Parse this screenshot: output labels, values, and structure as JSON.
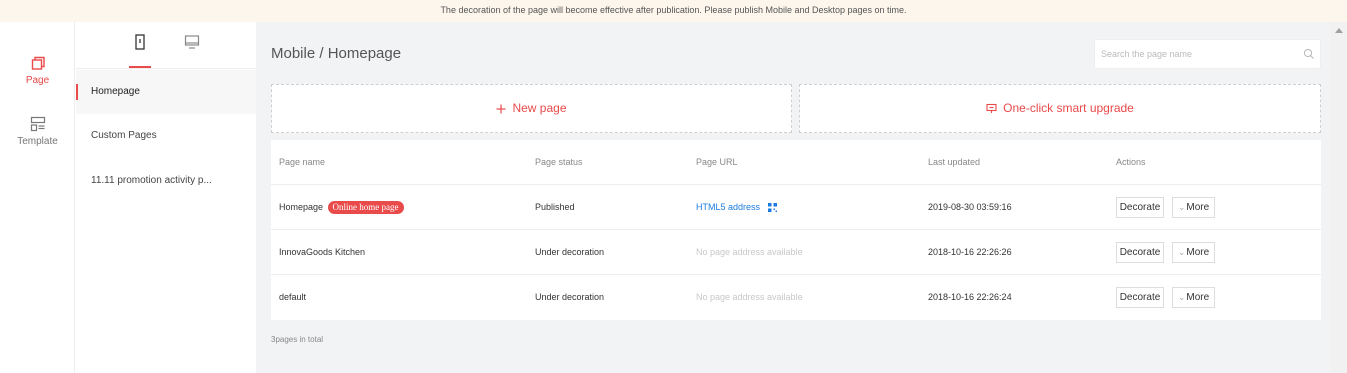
{
  "banner": {
    "text": "The decoration of the page will become effective after publication. Please publish Mobile and Desktop pages on time."
  },
  "nav": {
    "page_label": "Page",
    "template_label": "Template",
    "active_color": "#e94a4a"
  },
  "page_list": {
    "items": [
      {
        "label": "Homepage"
      },
      {
        "label": "Custom Pages"
      },
      {
        "label": "11.11 promotion activity p..."
      }
    ]
  },
  "main": {
    "breadcrumb": "Mobile / Homepage",
    "search_placeholder": "Search the page name",
    "new_page_label": "New page",
    "upgrade_label": "One-click smart upgrade",
    "columns": [
      "Page name",
      "Page status",
      "Page URL",
      "Last updated",
      "Actions"
    ],
    "rows": [
      {
        "name": "Homepage",
        "badge": "Online home page",
        "status": "Published",
        "url": "HTML5 address",
        "updated": "2019-08-30 03:59:16",
        "decorate": "Decorate",
        "more": "More"
      },
      {
        "name": "InnovaGoods Kitchen",
        "status": "Under decoration",
        "url": "No page address available",
        "updated": "2018-10-16 22:26:26",
        "decorate": "Decorate",
        "more": "More"
      },
      {
        "name": "default",
        "status": "Under decoration",
        "url": "No page address available",
        "updated": "2018-10-16 22:26:24",
        "decorate": "Decorate",
        "more": "More"
      }
    ],
    "total_text": "3pages in total"
  }
}
